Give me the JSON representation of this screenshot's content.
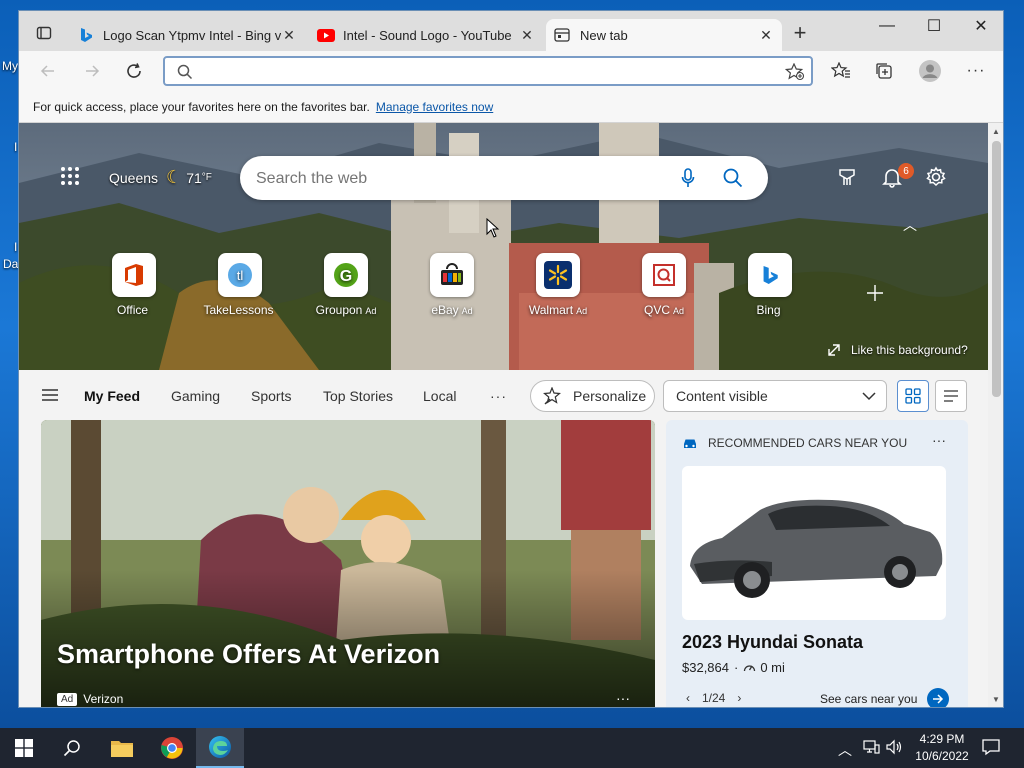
{
  "desktop": {
    "frag1": "My",
    "frag2": "Da",
    "frag3": "I"
  },
  "tabs": [
    {
      "title": "Logo Scan Ytpmv Intel - Bing vid",
      "close": "✕"
    },
    {
      "title": "Intel - Sound Logo - YouTube",
      "close": "✕"
    },
    {
      "title": "New tab",
      "close": "✕"
    }
  ],
  "new_tab": "+",
  "window_controls": {
    "minimize": "—",
    "maximize": "☐",
    "close": "✕"
  },
  "address_bar": {
    "value": "",
    "placeholder": ""
  },
  "favorites_bar": {
    "message": "For quick access, place your favorites here on the favorites bar.",
    "link": "Manage favorites now"
  },
  "hero": {
    "location": "Queens",
    "temperature": "71",
    "unit": "°F",
    "search_placeholder": "Search the web",
    "notification_count": "6",
    "like_background": "Like this background?"
  },
  "quick_links": [
    {
      "label": "Office",
      "ad": ""
    },
    {
      "label": "TakeLessons",
      "ad": ""
    },
    {
      "label": "Groupon",
      "ad": "Ad"
    },
    {
      "label": "eBay",
      "ad": "Ad"
    },
    {
      "label": "Walmart",
      "ad": "Ad"
    },
    {
      "label": "QVC",
      "ad": "Ad"
    },
    {
      "label": "Bing",
      "ad": ""
    }
  ],
  "feed_tabs": [
    "My Feed",
    "Gaming",
    "Sports",
    "Top Stories",
    "Local"
  ],
  "feed_more": "···",
  "personalize": "Personalize",
  "content_visibility": "Content visible",
  "main_card": {
    "headline": "Smartphone Offers At Verizon",
    "ad_badge": "Ad",
    "source": "Verizon",
    "more": "···"
  },
  "cars_card": {
    "header": "RECOMMENDED CARS NEAR YOU",
    "more": "···",
    "car": "2023 Hyundai Sonata",
    "price": "$32,864",
    "mileage": "0 mi",
    "pager": "1/24",
    "cta": "See cars near you"
  },
  "taskbar": {
    "time": "4:29 PM",
    "date": "10/6/2022"
  },
  "colors": {
    "accent": "#0067c0",
    "taskbar": "#1f2530",
    "tabstrip": "#dedede"
  }
}
